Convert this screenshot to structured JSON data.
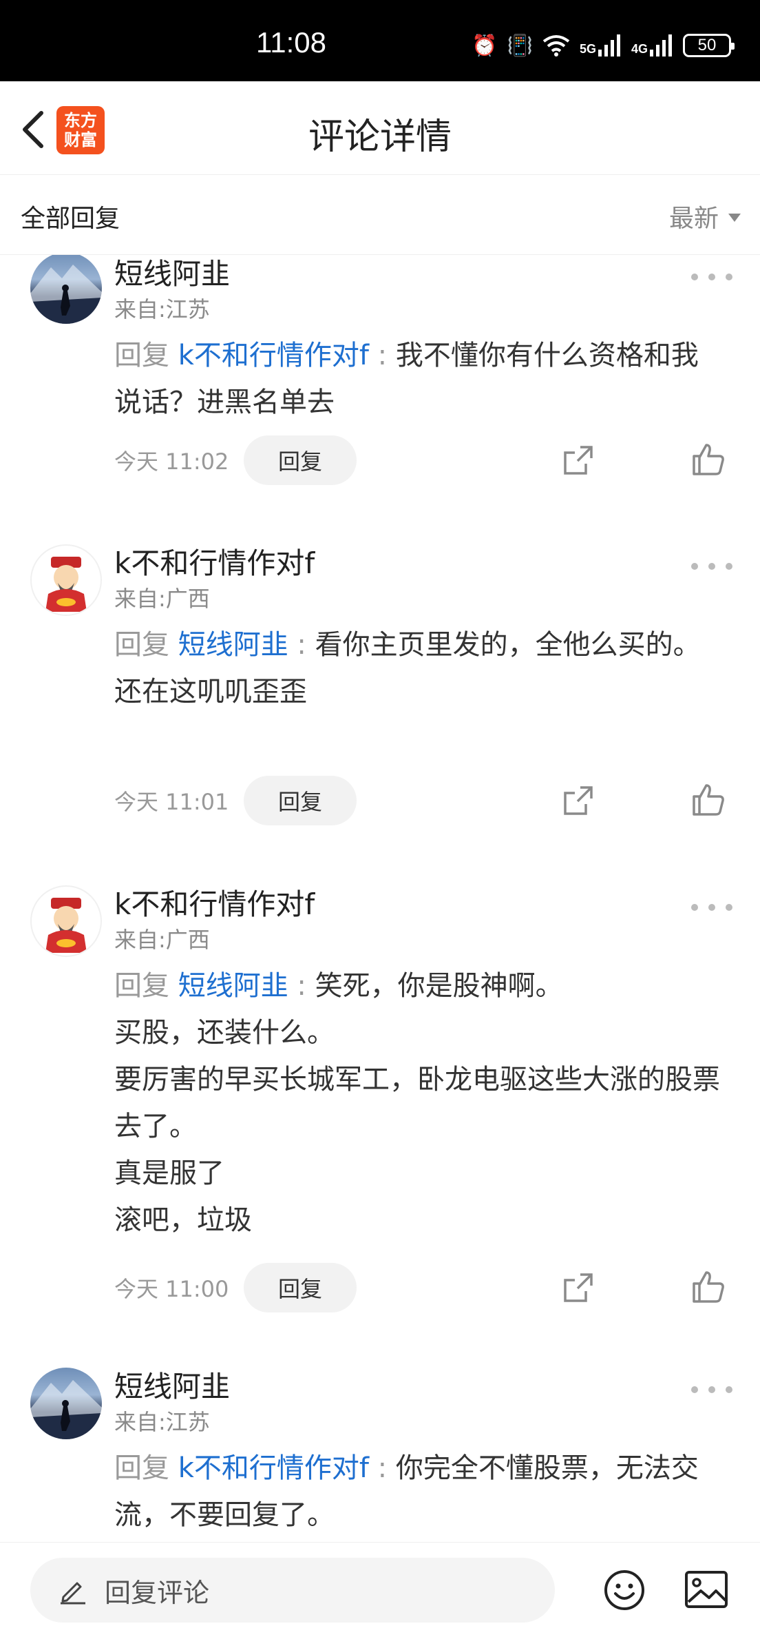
{
  "status_bar": {
    "time": "11:08",
    "battery": "50",
    "net_5g": "5G",
    "net_4g": "4G"
  },
  "header": {
    "title": "评论详情",
    "logo_line1": "东方",
    "logo_line2": "财富"
  },
  "subheader": {
    "all_replies": "全部回复",
    "sort": "最新"
  },
  "comments": [
    {
      "user": "短线阿韭",
      "location": "来自:江苏",
      "avatar": "mountain",
      "reply_prefix": "回复 ",
      "mention": "k不和行情作对f",
      "colon": " : ",
      "text": "我不懂你有什么资格和我说话？进黑名单去",
      "time": "今天 11:02",
      "reply_label": "回复"
    },
    {
      "user": "k不和行情作对f",
      "location": "来自:广西",
      "avatar": "caishen",
      "reply_prefix": "回复 ",
      "mention": "短线阿韭",
      "colon": " : ",
      "text_lines": [
        "看你主页里发的，全他么买的。",
        "还在这叽叽歪歪"
      ],
      "time": "今天 11:01",
      "reply_label": "回复"
    },
    {
      "user": "k不和行情作对f",
      "location": "来自:广西",
      "avatar": "caishen",
      "reply_prefix": "回复 ",
      "mention": "短线阿韭",
      "colon": " : ",
      "text_lines": [
        "笑死，你是股神啊。",
        "买股，还装什么。",
        "要厉害的早买长城军工，卧龙电驱这些大涨的股票去了。",
        "真是服了",
        "滚吧，垃圾"
      ],
      "time": "今天 11:00",
      "reply_label": "回复"
    },
    {
      "user": "短线阿韭",
      "location": "来自:江苏",
      "avatar": "mountain",
      "reply_prefix": "回复 ",
      "mention": "k不和行情作对f",
      "colon": " : ",
      "text": "你完全不懂股票，无法交流，不要回复了。"
    }
  ],
  "bottom_bar": {
    "placeholder": "回复评论"
  },
  "icons": [
    "back-arrow-icon",
    "more-dots-icon",
    "share-icon",
    "thumbs-up-icon",
    "pencil-icon",
    "emoji-icon",
    "image-icon"
  ]
}
